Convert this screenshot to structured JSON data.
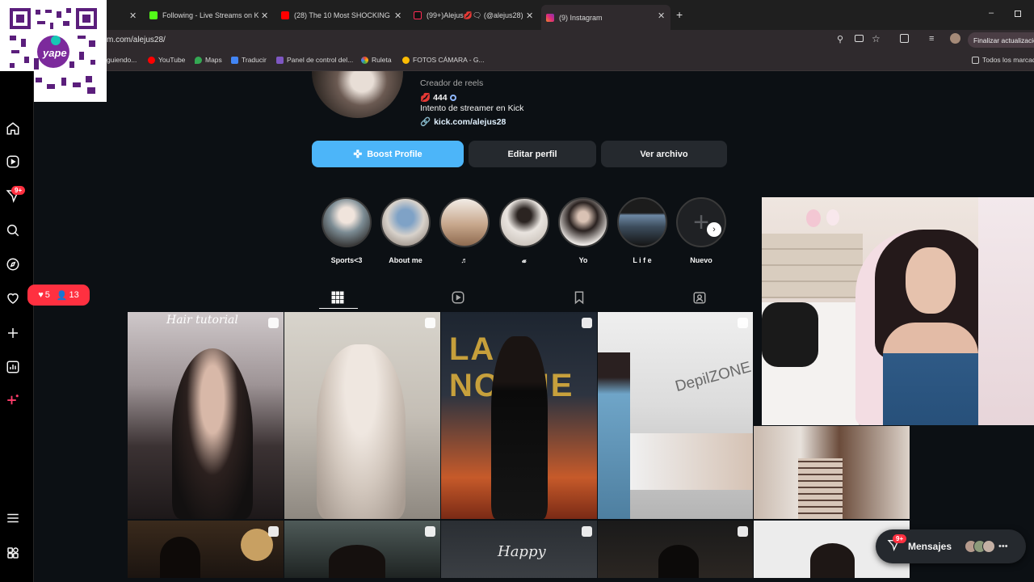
{
  "browser": {
    "tabs": [
      {
        "title": "Following - Live Streams on Kick",
        "color": "#53fc18"
      },
      {
        "title": "(28) The 10 Most SHOCKING P",
        "color": "#ff0000"
      },
      {
        "title": "(99+)Alejus💋🗨 (@alejus28) |",
        "color": "#222222"
      },
      {
        "title": "(9) Instagram",
        "color": "#e1306c"
      }
    ],
    "address": "m.com/alejus28/",
    "update_button": "Finalizar actualizació",
    "bookmarks": [
      {
        "label": "guiendo...",
        "color": "#888888"
      },
      {
        "label": "YouTube",
        "color": "#ff0000"
      },
      {
        "label": "Maps",
        "color": "#34a853"
      },
      {
        "label": "Traducir",
        "color": "#4285f4"
      },
      {
        "label": "Panel de control del...",
        "color": "#7e57c2"
      },
      {
        "label": "Ruleta",
        "color": "#ea4335"
      },
      {
        "label": "FOTOS CÁMARA - G...",
        "color": "#fbbc04"
      }
    ],
    "all_bookmarks": "Todos los marcad"
  },
  "qr": {
    "brand": "yape"
  },
  "sidebar": {
    "notifications_badge": "9+"
  },
  "notif_popup": {
    "likes": "5",
    "follows": "13"
  },
  "profile": {
    "category": "Creador de reels",
    "count_line": "444",
    "bio": "Intento de streamer en Kick",
    "link": "kick.com/alejus28",
    "buttons": {
      "boost": "Boost Profile",
      "edit": "Editar perfil",
      "archive": "Ver archivo"
    }
  },
  "highlights": [
    {
      "label": "Sports<3"
    },
    {
      "label": "About me"
    },
    {
      "label": "♬"
    },
    {
      "label": "𝓪"
    },
    {
      "label": "Yo"
    },
    {
      "label": "L i f e"
    },
    {
      "label": "Nuevo"
    }
  ],
  "grid_tiles": [
    {
      "text": "Hair tutorial"
    },
    {
      "text": ""
    },
    {
      "text": "LA NOCHE"
    },
    {
      "text": "DepilZONE"
    },
    {
      "text": ""
    },
    {
      "text": "Happy"
    }
  ],
  "messages": {
    "label": "Mensajes",
    "badge": "9+"
  },
  "colors": {
    "accent": "#0095f6",
    "badge": "#ff3040",
    "bg": "#0c1014"
  }
}
